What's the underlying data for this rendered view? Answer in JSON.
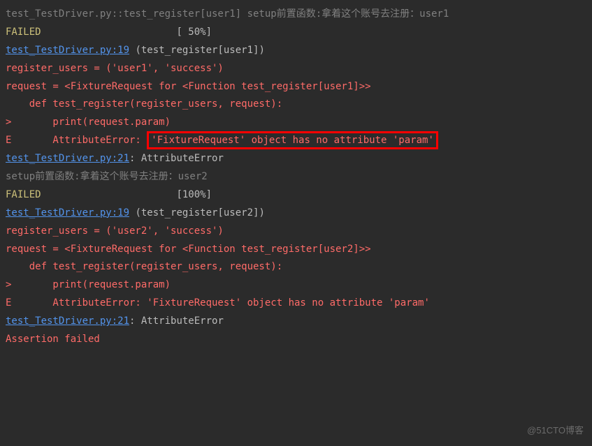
{
  "lines": {
    "l1": "test_TestDriver.py::test_register[user1] setup前置函数:拿着这个账号去注册：user1",
    "l2a": "FAILED",
    "l2b": "                       [ 50%]",
    "l3a": "test_TestDriver.py:19",
    "l3b": " (test_register[user1])",
    "l4": "register_users = ('user1', 'success')",
    "l5": "request = <FixtureRequest for <Function test_register[user1]>>",
    "l6": "",
    "l7": "    def test_register(register_users, request):",
    "l8": ">       print(request.param)",
    "l9a": "E       AttributeError: ",
    "l9b": "'FixtureRequest' object has no attribute 'param'",
    "l10": "",
    "l11a": "test_TestDriver.py:21",
    "l11b": ": AttributeError",
    "l12": "setup前置函数:拿着这个账号去注册：user2",
    "l13a": "FAILED",
    "l13b": "                       [100%]",
    "l14a": "test_TestDriver.py:19",
    "l14b": " (test_register[user2])",
    "l15": "register_users = ('user2', 'success')",
    "l16": "request = <FixtureRequest for <Function test_register[user2]>>",
    "l17": "",
    "l18": "    def test_register(register_users, request):",
    "l19": ">       print(request.param)",
    "l20": "E       AttributeError: 'FixtureRequest' object has no attribute 'param'",
    "l21": "",
    "l22a": "test_TestDriver.py:21",
    "l22b": ": AttributeError",
    "l23": "",
    "l24": "Assertion failed"
  },
  "watermark": "@51CTO博客"
}
